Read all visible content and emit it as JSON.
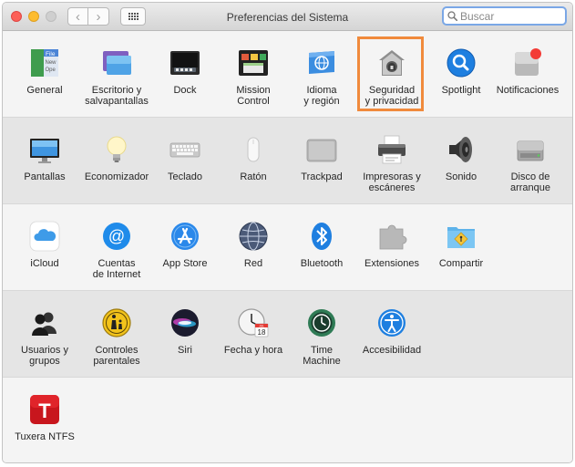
{
  "window": {
    "title": "Preferencias del Sistema",
    "search_placeholder": "Buscar"
  },
  "rows": [
    [
      {
        "label": "General",
        "icon": "general-icon"
      },
      {
        "label": "Escritorio y\nsalvapantallas",
        "icon": "desktop-screensaver-icon"
      },
      {
        "label": "Dock",
        "icon": "dock-icon"
      },
      {
        "label": "Mission\nControl",
        "icon": "mission-control-icon"
      },
      {
        "label": "Idioma\ny región",
        "icon": "language-region-icon"
      },
      {
        "label": "Seguridad\ny privacidad",
        "icon": "security-privacy-icon"
      },
      {
        "label": "Spotlight",
        "icon": "spotlight-icon"
      },
      {
        "label": "Notificaciones",
        "icon": "notifications-icon"
      }
    ],
    [
      {
        "label": "Pantallas",
        "icon": "displays-icon"
      },
      {
        "label": "Economizador",
        "icon": "energy-saver-icon"
      },
      {
        "label": "Teclado",
        "icon": "keyboard-icon"
      },
      {
        "label": "Ratón",
        "icon": "mouse-icon"
      },
      {
        "label": "Trackpad",
        "icon": "trackpad-icon"
      },
      {
        "label": "Impresoras y\nescáneres",
        "icon": "printer-icon"
      },
      {
        "label": "Sonido",
        "icon": "speaker-icon"
      },
      {
        "label": "Disco de\narranque",
        "icon": "startup-disk-icon"
      }
    ],
    [
      {
        "label": "iCloud",
        "icon": "icloud-icon"
      },
      {
        "label": "Cuentas\nde Internet",
        "icon": "internet-accounts-icon"
      },
      {
        "label": "App Store",
        "icon": "app-store-icon"
      },
      {
        "label": "Red",
        "icon": "network-globe-icon"
      },
      {
        "label": "Bluetooth",
        "icon": "bluetooth-icon"
      },
      {
        "label": "Extensiones",
        "icon": "extensions-puzzle-icon"
      },
      {
        "label": "Compartir",
        "icon": "sharing-folder-icon"
      }
    ],
    [
      {
        "label": "Usuarios y\ngrupos",
        "icon": "users-groups-icon"
      },
      {
        "label": "Controles\nparentales",
        "icon": "parental-controls-icon"
      },
      {
        "label": "Siri",
        "icon": "siri-icon"
      },
      {
        "label": "Fecha y hora",
        "icon": "date-time-icon"
      },
      {
        "label": "Time\nMachine",
        "icon": "time-machine-icon"
      },
      {
        "label": "Accesibilidad",
        "icon": "accessibility-icon"
      }
    ],
    [
      {
        "label": "Tuxera NTFS",
        "icon": "tuxera-ntfs-icon"
      }
    ]
  ],
  "icon_texts": {
    "general": [
      "File",
      "New",
      "Ope"
    ],
    "calendar_day": "18",
    "calendar_month": "JUL",
    "tuxera_letter": "T"
  },
  "colors": {
    "highlight": "#f08a3c",
    "search_focus": "#7aa7e6",
    "notification_badge": "#f33b36"
  }
}
